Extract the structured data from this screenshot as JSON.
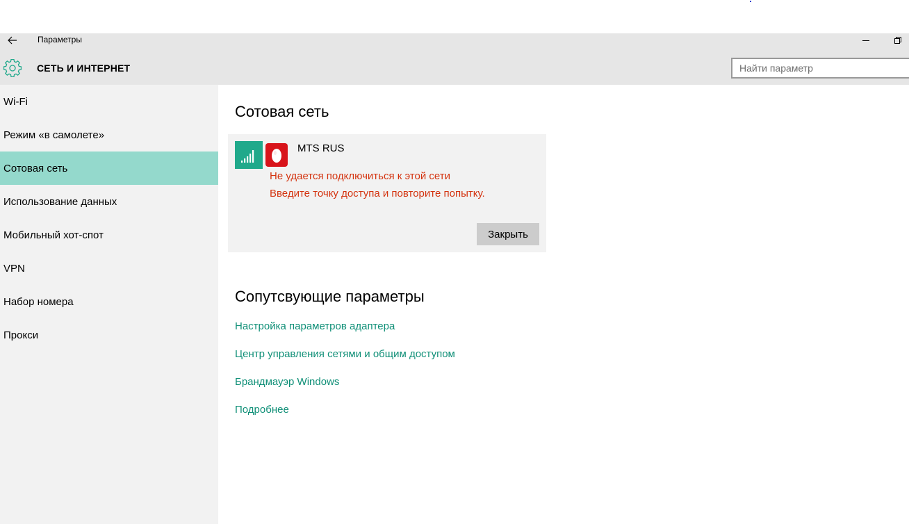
{
  "window": {
    "title": "Параметры",
    "back_icon": "back-arrow-icon",
    "minimize_icon": "minimize-icon",
    "restore_icon": "restore-icon"
  },
  "header": {
    "icon": "gear-icon",
    "title": "СЕТЬ И ИНТЕРНЕТ",
    "search_placeholder": "Найти параметр",
    "search_value": ""
  },
  "sidebar": {
    "items": [
      {
        "label": "Wi-Fi",
        "active": false
      },
      {
        "label": "Режим «в самолете»",
        "active": false
      },
      {
        "label": "Сотовая сеть",
        "active": true
      },
      {
        "label": "Использование данных",
        "active": false
      },
      {
        "label": "Мобильный хот-спот",
        "active": false
      },
      {
        "label": "VPN",
        "active": false
      },
      {
        "label": "Набор номера",
        "active": false
      },
      {
        "label": "Прокси",
        "active": false
      }
    ]
  },
  "main": {
    "title": "Сотовая сеть",
    "network": {
      "operator": "MTS RUS",
      "signal_icon": "signal-bars-icon",
      "logo_icon": "mts-egg-logo-icon",
      "error_line1": "Не удается подключиться к этой сети",
      "error_line2": "Введите точку доступа и повторите попытку.",
      "close_label": "Закрыть"
    },
    "related": {
      "title": "Сопутсвующие параметры",
      "links": [
        "Настройка параметров адаптера",
        "Центр управления сетями и общим доступом",
        "Брандмауэр Windows",
        "Подробнее"
      ]
    }
  },
  "colors": {
    "accent": "#20a98b",
    "active_nav": "#94d9cc",
    "link": "#0f8f77",
    "error": "#d4330f",
    "sidebar_bg": "#f2f2f2",
    "header_bg": "#e6e6e6"
  }
}
